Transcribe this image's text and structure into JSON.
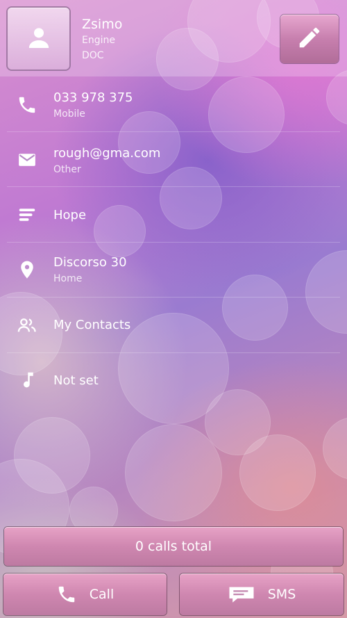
{
  "contact": {
    "name": "Zsimo",
    "line1": "Engine",
    "line2": "DOC"
  },
  "details": [
    {
      "icon": "phone-icon",
      "value": "033 978 375",
      "label": "Mobile"
    },
    {
      "icon": "email-icon",
      "value": "rough@gma.com",
      "label": "Other"
    },
    {
      "icon": "notes-icon",
      "value": "Hope",
      "label": ""
    },
    {
      "icon": "location-icon",
      "value": "Discorso 30",
      "label": "Home"
    },
    {
      "icon": "group-icon",
      "value": "My Contacts",
      "label": ""
    },
    {
      "icon": "ringtone-icon",
      "value": "Not set",
      "label": ""
    }
  ],
  "footer": {
    "calls_total": "0 calls total",
    "call_label": "Call",
    "sms_label": "SMS"
  },
  "icons": {
    "avatar": "person-icon",
    "edit": "pencil-icon"
  }
}
